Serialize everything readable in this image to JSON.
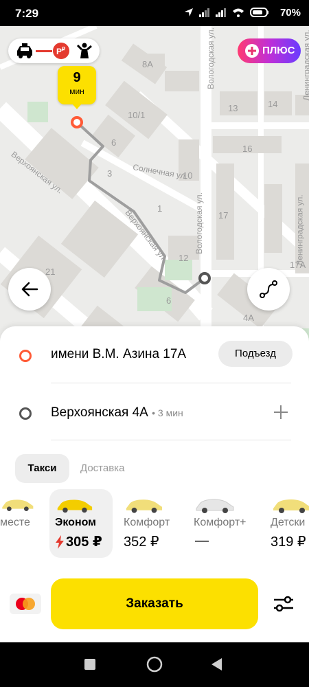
{
  "status_bar": {
    "time": "7:29",
    "battery": "70%"
  },
  "map": {
    "plus_label": "ПЛЮС",
    "eta": {
      "value": "9",
      "unit": "мин"
    },
    "streets": [
      "Верхоянская ул.",
      "Солнечная ул.",
      "Верхоянская ул.",
      "Вологодская ул.",
      "Вологодская ул.",
      "Ленинградская ул.",
      "Ленинградская ул."
    ],
    "buildings": [
      "8А",
      "10/1",
      "6",
      "3",
      "1",
      "10",
      "12",
      "13",
      "14",
      "16",
      "17",
      "6",
      "21",
      "4А",
      "17А"
    ]
  },
  "route": {
    "from": "имени В.М. Азина 17А",
    "entrance_label": "Подъезд",
    "to": "Верхоянская 4А",
    "to_eta": "• 3 мин"
  },
  "tabs": [
    {
      "label": "Такси",
      "active": true
    },
    {
      "label": "Доставка",
      "active": false
    }
  ],
  "tariffs": [
    {
      "name": "месте",
      "price": "",
      "color": "#f1de7a"
    },
    {
      "name": "Эконом",
      "price": "305 ₽",
      "selected": true,
      "color": "#f3cd00"
    },
    {
      "name": "Комфорт",
      "price": "352 ₽",
      "color": "#f1de7a"
    },
    {
      "name": "Комфорт+",
      "price": "—",
      "color": "#eeeeee"
    },
    {
      "name": "Детски",
      "price": "319 ₽",
      "color": "#f1de7a"
    }
  ],
  "order": {
    "label": "Заказать"
  },
  "colors": {
    "accent": "#fce000",
    "origin_pin": "#ff5a36",
    "route": "#9e9e9e"
  }
}
